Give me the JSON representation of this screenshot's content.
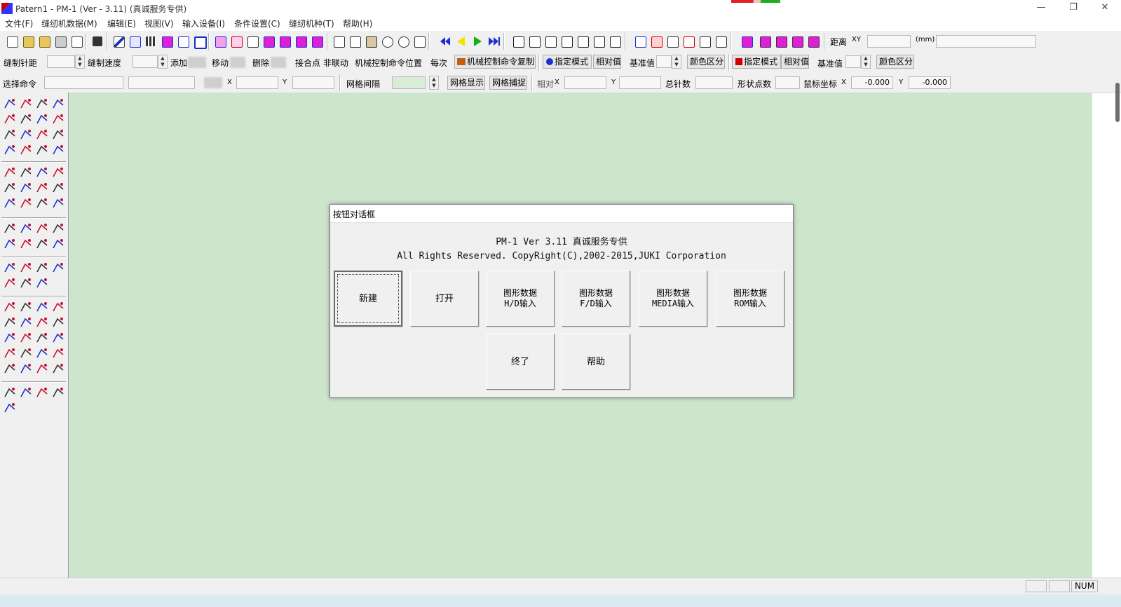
{
  "window": {
    "title": "Patern1 - PM-1 (Ver - 3.11) (真诚服务专供)",
    "minimize_glyph": "—",
    "restore_glyph": "❐",
    "close_glyph": "✕"
  },
  "menu": [
    {
      "label": "文件(F)"
    },
    {
      "label": "缝纫机数据(M)"
    },
    {
      "label": "编辑(E)"
    },
    {
      "label": "视图(V)"
    },
    {
      "label": "输入设备(I)"
    },
    {
      "label": "条件设置(C)"
    },
    {
      "label": "缝纫机种(T)"
    },
    {
      "label": "帮助(H)"
    }
  ],
  "toolbar1": {
    "distance_label": "距离",
    "xy_label": "XY",
    "unit_label": "(mm)",
    "accent_colors": {
      "blue": "#1e2fd0",
      "yellow": "#f2e400",
      "green": "#16b016",
      "magenta": "#e01ed8"
    }
  },
  "toolbar2": {
    "stitch_pitch": "缝制针距",
    "sew_speed": "缝制速度",
    "add": "添加",
    "move": "移动",
    "delete": "删除",
    "joint_unlinked": "接合点 非联动",
    "machine_cmd_pos": "机械控制命令位置",
    "each_time": "每次",
    "machine_cmd_copy": "机械控制命令复制",
    "specify_mode_1": "指定模式",
    "relative_value_1": "相对值",
    "reference_value_1": "基准值",
    "color_distinguish_1": "颜色区分",
    "specify_mode_2": "指定模式",
    "relative_value_2": "相对值",
    "reference_value_2": "基准值",
    "color_distinguish_2": "颜色区分"
  },
  "toolbar3": {
    "select_command": "选择命令",
    "x_label": "X",
    "y_label": "Y",
    "grid_spacing": "网格间隔",
    "grid_show": "网格显示",
    "grid_snap": "网格捕捉",
    "relative": "相对",
    "x2_label": "X",
    "y2_label": "Y",
    "total_stitches": "总针数",
    "shape_points": "形状点数",
    "cursor_coords": "鼠标坐标",
    "cursor_x_label": "X",
    "cursor_x": "-0.000",
    "cursor_y_label": "Y",
    "cursor_y": "-0.000"
  },
  "canvas": {
    "background": "#cde5cd"
  },
  "dialog": {
    "title": "按钮对话框",
    "line1": "PM-1 Ver 3.11 真诚服务专供",
    "line2": "All Rights Reserved. CopyRight(C),2002-2015,JUKI Corporation",
    "buttons": {
      "new": "新建",
      "open": "打开",
      "hd_input": "图形数据\nH/D输入",
      "fd_input": "图形数据\nF/D输入",
      "media_input": "图形数据\nMEDIA输入",
      "rom_input": "图形数据\nROM输入",
      "end": "终了",
      "help": "帮助"
    }
  },
  "statusbar": {
    "num": "NUM"
  }
}
